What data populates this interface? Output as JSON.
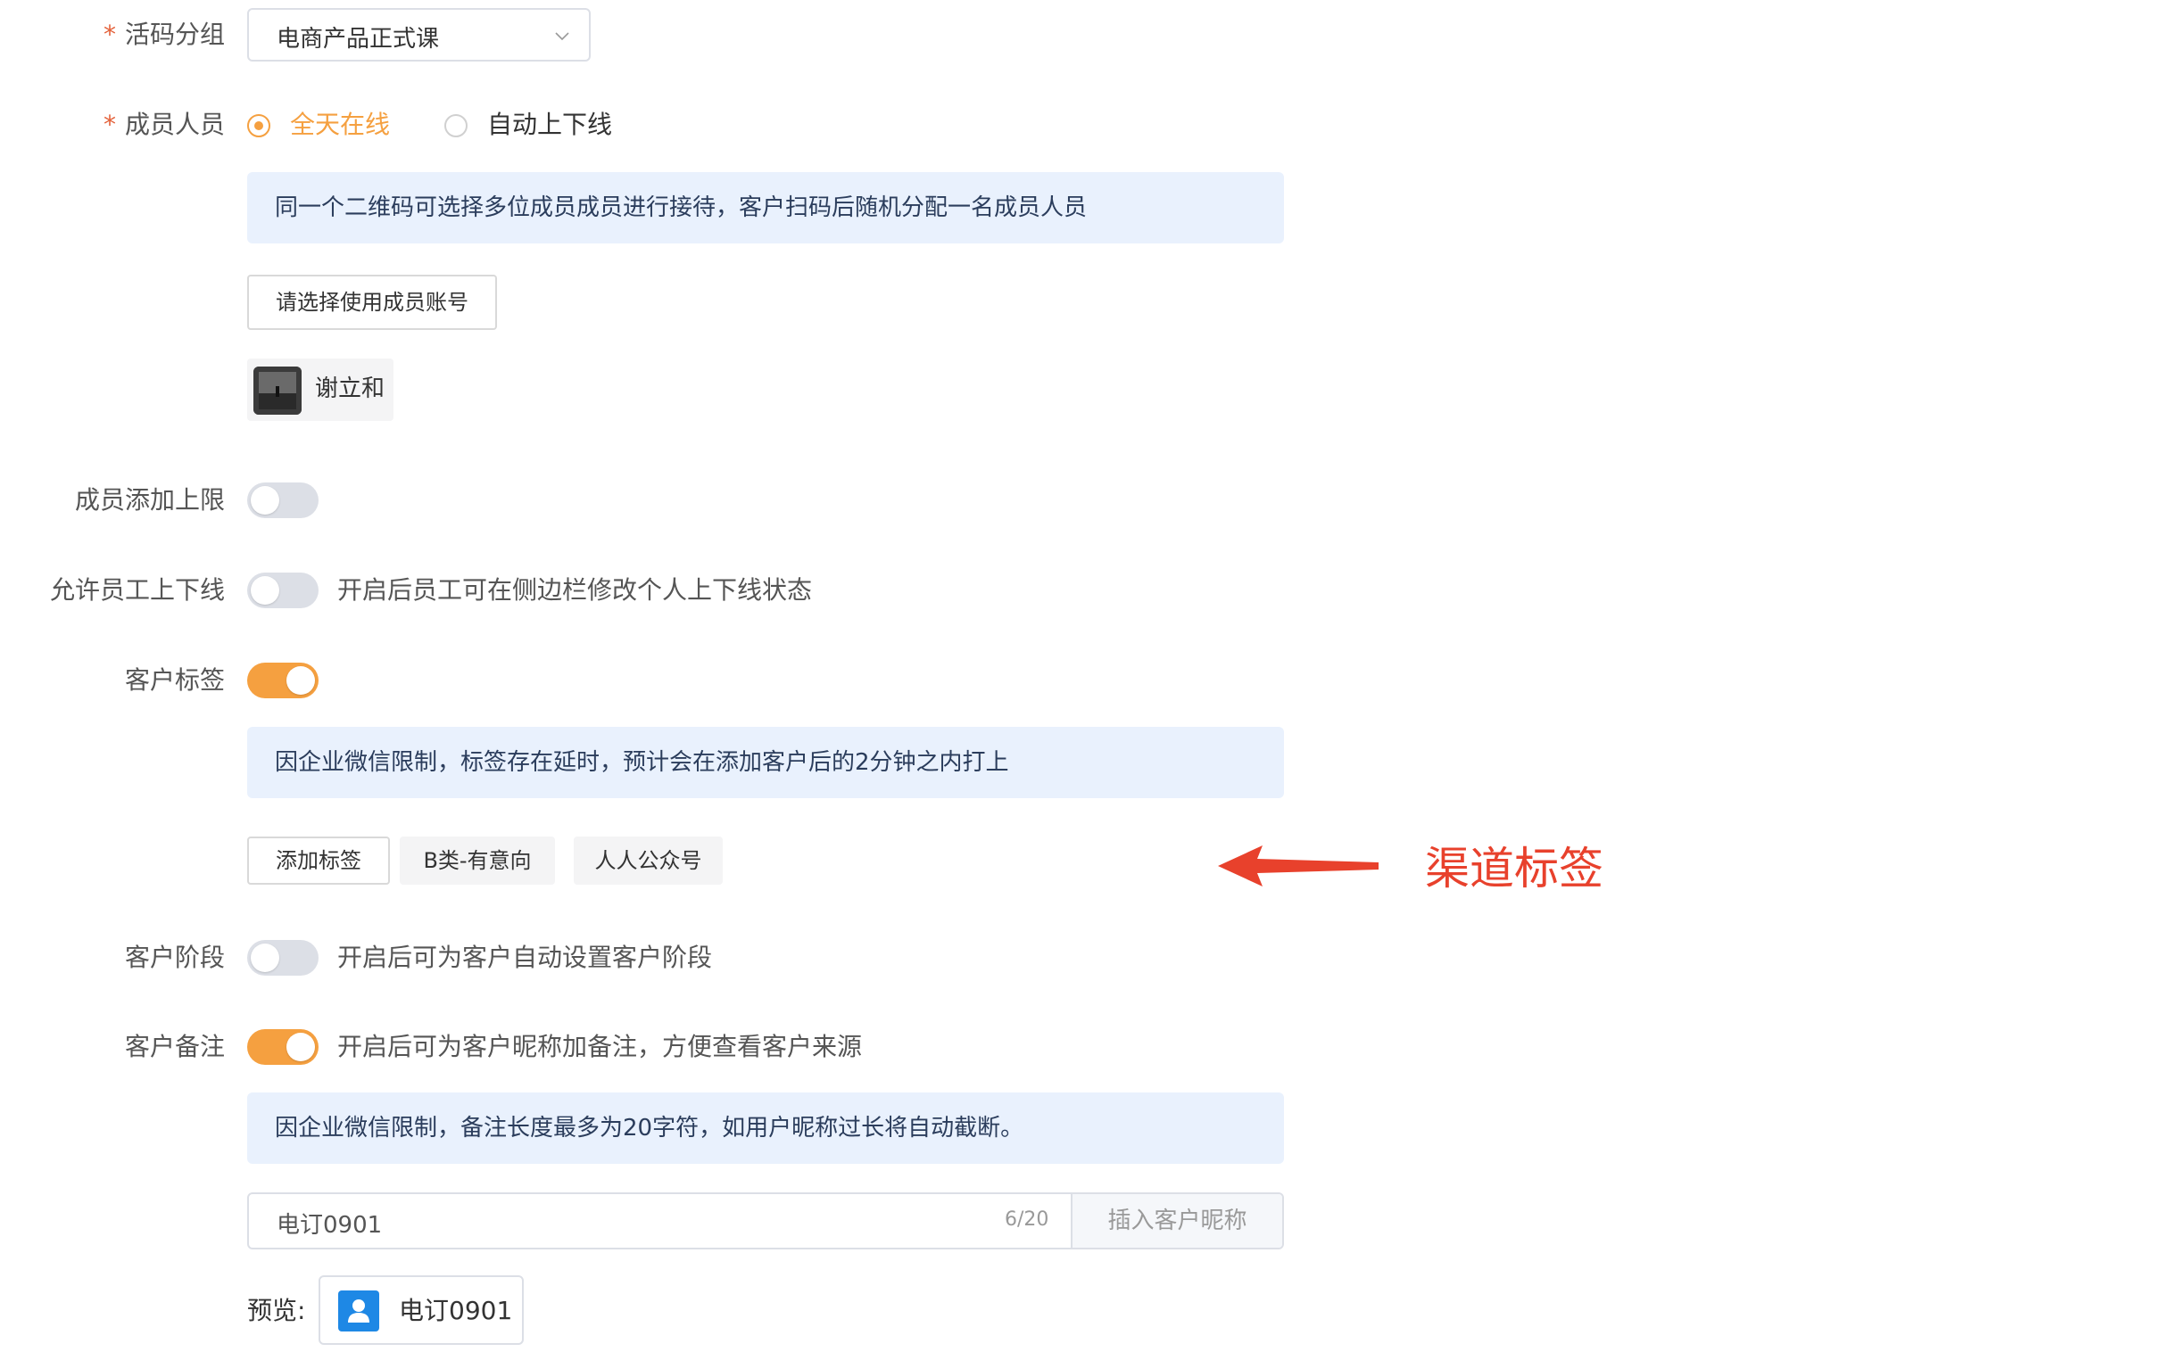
{
  "form": {
    "group": {
      "label": "活码分组",
      "required_mark": "*",
      "value": "电商产品正式课"
    },
    "members": {
      "label": "成员人员",
      "required_mark": "*",
      "options": [
        {
          "label": "全天在线",
          "selected": true
        },
        {
          "label": "自动上下线",
          "selected": false
        }
      ],
      "info": "同一个二维码可选择多位成员成员进行接待，客户扫码后随机分配一名成员人员",
      "select_button": "请选择使用成员账号",
      "selected_member": "谢立和"
    },
    "member_limit": {
      "label": "成员添加上限",
      "enabled": false
    },
    "allow_online": {
      "label": "允许员工上下线",
      "enabled": false,
      "hint": "开启后员工可在侧边栏修改个人上下线状态"
    },
    "customer_tags": {
      "label": "客户标签",
      "enabled": true,
      "info": "因企业微信限制，标签存在延时，预计会在添加客户后的2分钟之内打上",
      "add_button": "添加标签",
      "tags": [
        "B类-有意向",
        "人人公众号"
      ]
    },
    "customer_stage": {
      "label": "客户阶段",
      "enabled": false,
      "hint": "开启后可为客户自动设置客户阶段"
    },
    "customer_remark": {
      "label": "客户备注",
      "enabled": true,
      "hint": "开启后可为客户昵称加备注，方便查看客户来源",
      "info": "因企业微信限制，备注长度最多为20字符，如用户昵称过长将自动截断。",
      "input_value": "电订0901",
      "counter": "6/20",
      "insert_button": "插入客户昵称",
      "preview_label": "预览:",
      "preview_name": "电订0901"
    }
  },
  "annotation": {
    "text": "渠道标签",
    "color": "#e8412c"
  },
  "colors": {
    "accent": "#f5a040",
    "info_bg": "#e9f1fd",
    "required": "#e4623b",
    "avatar_blue": "#1e88e5"
  },
  "icons": [
    "chevron-down-icon",
    "user-icon",
    "arrow-left-icon"
  ]
}
